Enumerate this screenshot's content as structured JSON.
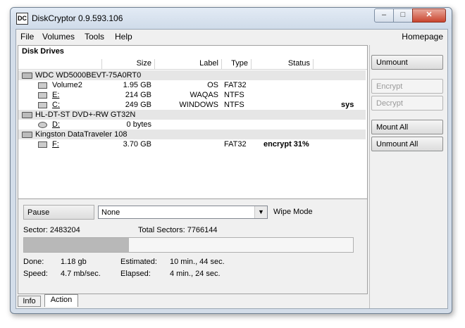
{
  "window": {
    "title": "DiskCryptor 0.9.593.106",
    "icon_name": "diskcryptor-app-icon",
    "controls": [
      "minimize-icon",
      "maximize-icon",
      "close-icon"
    ]
  },
  "menu": {
    "items": [
      "File",
      "Volumes",
      "Tools",
      "Help"
    ],
    "homepage": "Homepage"
  },
  "drives": {
    "title": "Disk Drives",
    "columns": {
      "size": "Size",
      "label": "Label",
      "type": "Type",
      "status": "Status"
    },
    "groups": [
      {
        "name": "WDC WD5000BEVT-75A0RT0",
        "volumes": [
          {
            "name": "Volume2",
            "size": "1.95 GB",
            "label": "OS",
            "type": "FAT32",
            "status": "",
            "extra": ""
          },
          {
            "name": "E:",
            "size": "214 GB",
            "label": "WAQAS",
            "type": "NTFS",
            "status": "",
            "extra": ""
          },
          {
            "name": "C:",
            "size": "249 GB",
            "label": "WINDOWS",
            "type": "NTFS",
            "status": "",
            "extra": "sys"
          }
        ]
      },
      {
        "name": "HL-DT-ST DVD+-RW GT32N",
        "volumes": [
          {
            "name": "D:",
            "size": "0 bytes",
            "label": "",
            "type": "",
            "status": "",
            "extra": ""
          }
        ]
      },
      {
        "name": "Kingston DataTraveler 108",
        "volumes": [
          {
            "name": "F:",
            "size": "3.70 GB",
            "label": "",
            "type": "FAT32",
            "status": "encrypt 31%",
            "extra": ""
          }
        ]
      }
    ]
  },
  "buttons": {
    "unmount": "Unmount",
    "encrypt": "Encrypt",
    "decrypt": "Decrypt",
    "mount_all": "Mount All",
    "unmount_all": "Unmount All"
  },
  "action": {
    "pause": "Pause",
    "wipe_select": "None",
    "wipe_label": "Wipe Mode",
    "sector": "Sector: 2483204",
    "total_sectors": "Total Sectors: 7766144",
    "progress": 0.32,
    "done_label": "Done:",
    "done_value": "1.18 gb",
    "speed_label": "Speed:",
    "speed_value": "4.7 mb/sec.",
    "estimated_label": "Estimated:",
    "estimated_value": "10 min., 44 sec.",
    "elapsed_label": "Elapsed:",
    "elapsed_value": "4 min., 24 sec."
  },
  "tabs": [
    "Info",
    "Action"
  ]
}
